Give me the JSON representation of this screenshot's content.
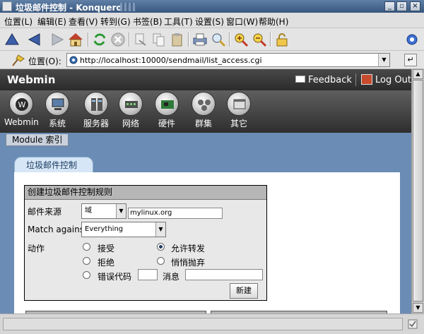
{
  "window": {
    "title": "垃圾邮件控制 - Konqueror",
    "buttons": [
      "_",
      "▫",
      "×"
    ]
  },
  "menu": [
    "位置(L)",
    "编辑(E)",
    "查看(V)",
    "转到(G)",
    "书签(B)",
    "工具(T)",
    "设置(S)",
    "窗口(W)",
    "帮助(H)"
  ],
  "location": {
    "label": "位置(O):",
    "url": "http://localhost:10000/sendmail/list_access.cgi"
  },
  "webmin": {
    "logo": "Webmin",
    "feedback": "Feedback",
    "logout": "Log Out",
    "categories": [
      "Webmin",
      "系统",
      "服务器",
      "网络",
      "硬件",
      "群集",
      "其它"
    ],
    "module_index": "Module 索引",
    "page_tab": "垃圾邮件控制"
  },
  "form": {
    "title": "创建垃圾邮件控制规则",
    "source_label": "邮件来源",
    "source_type": "域",
    "source_value": "mylinux.org",
    "match_label": "Match against",
    "match_value": "Everything",
    "action_label": "动作",
    "actions": [
      "接受",
      "允许转发",
      "拒绝",
      "悄悄抛弃",
      "错误代码"
    ],
    "selected_action": "允许转发",
    "message_label": "消息",
    "error_code_value": "",
    "message_value": "",
    "create_button": "新建"
  },
  "colors": {
    "titlebar": "#4a6a94",
    "page_background": "#6b8cb4",
    "header": "#2f2f2f"
  }
}
